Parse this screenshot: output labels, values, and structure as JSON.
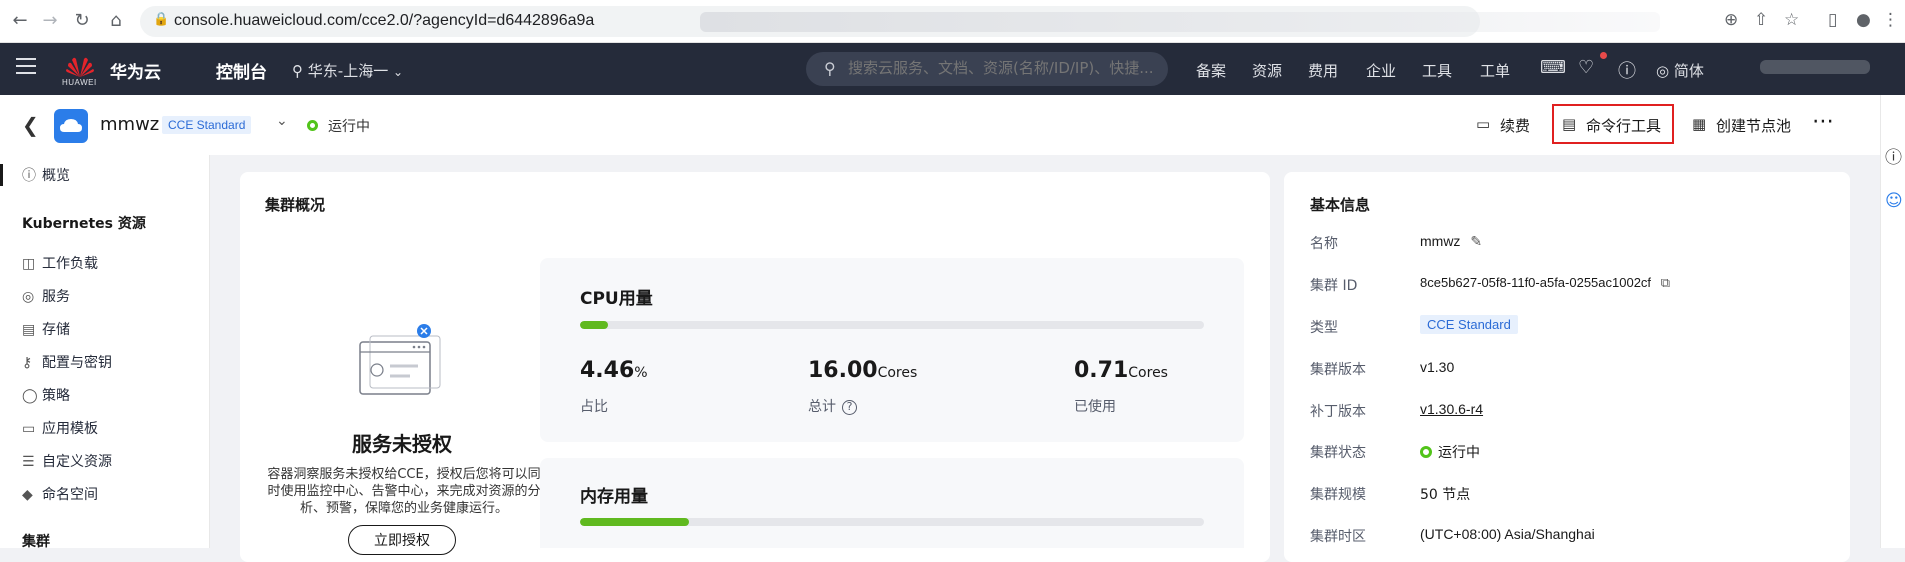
{
  "browser": {
    "url": "console.huaweicloud.com/cce2.0/?agencyId=d6442896a9a"
  },
  "topnav": {
    "logo_caption": "HUAWEI",
    "brand": "华为云",
    "console": "控制台",
    "region": "华东-上海一",
    "search_placeholder": "搜索云服务、文档、资源(名称/ID/IP)、快捷...",
    "links": [
      "备案",
      "资源",
      "费用",
      "企业",
      "工具",
      "工单"
    ],
    "lang": "简体"
  },
  "cluster": {
    "name": "mmwz",
    "edition": "CCE Standard",
    "status": "运行中",
    "actions": {
      "renew": "续费",
      "cli_tool": "命令行工具",
      "create_node_pool": "创建节点池"
    }
  },
  "sidebar": {
    "overview": "概览",
    "group_k8s": "Kubernetes 资源",
    "items": [
      "工作负载",
      "服务",
      "存储",
      "配置与密钥",
      "策略",
      "应用模板",
      "自定义资源",
      "命名空间"
    ],
    "group_cluster": "集群"
  },
  "overview": {
    "title": "集群概况",
    "auth": {
      "title": "服务未授权",
      "desc": "容器洞察服务未授权给CCE，授权后您将可以同时使用监控中心、告警中心，来完成对资源的分析、预警，保障您的业务健康运行。",
      "button": "立即授权"
    },
    "cpu": {
      "title": "CPU用量",
      "usage_fraction": 0.0446,
      "ratio_value": "4.46",
      "ratio_unit": "%",
      "ratio_label": "占比",
      "total_value": "16.00",
      "total_unit": "Cores",
      "total_label": "总计",
      "used_value": "0.71",
      "used_unit": "Cores",
      "used_label": "已使用"
    },
    "memory": {
      "title": "内存用量",
      "usage_fraction": 0.175
    }
  },
  "basic_info": {
    "title": "基本信息",
    "rows": [
      {
        "label": "名称",
        "value": "mmwz"
      },
      {
        "label": "集群 ID",
        "value": "8ce5b627-05f8-11f0-a5fa-0255ac1002cf"
      },
      {
        "label": "类型",
        "value": "CCE Standard"
      },
      {
        "label": "集群版本",
        "value": "v1.30"
      },
      {
        "label": "补丁版本",
        "value": "v1.30.6-r4"
      },
      {
        "label": "集群状态",
        "value": "运行中"
      },
      {
        "label": "集群规模",
        "value": "50 节点"
      },
      {
        "label": "集群时区",
        "value": "(UTC+08:00) Asia/Shanghai"
      }
    ]
  },
  "colors": {
    "nav_bg": "#252b3a",
    "accent_blue": "#2b7de9",
    "success_green": "#52c41a",
    "bar_green": "#60b91f",
    "highlight_red": "#e02020"
  }
}
